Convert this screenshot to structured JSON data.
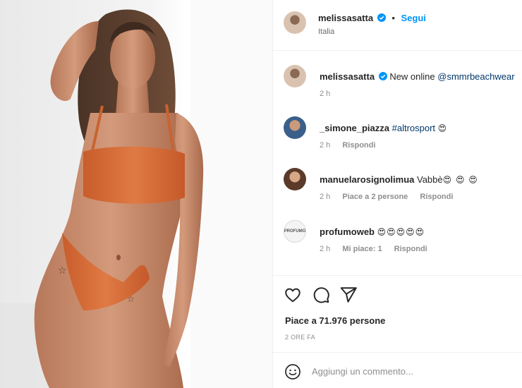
{
  "post": {
    "username": "melissasatta",
    "follow_label": "Segui",
    "dot": "•",
    "location": "Italia"
  },
  "comments": [
    {
      "username": "melissasatta",
      "text": "New online",
      "mention": "@smmrbeachwear",
      "time": "2 h"
    },
    {
      "username": "_simone_piazza",
      "hashtag": "#altrosport",
      "emoji": "😍",
      "time": "2 h",
      "reply": "Rispondi"
    },
    {
      "username": "manuelarosignolimua",
      "text": "Vabbè",
      "emoji": "😍 😍 😍",
      "time": "2 h",
      "likes": "Piace a 2 persone",
      "reply": "Rispondi"
    },
    {
      "username": "profumoweb",
      "emoji": "😍😍😍😍😍",
      "time": "2 h",
      "likes": "Mi piace: 1",
      "reply": "Rispondi",
      "avatar_text": "PROFUMO"
    }
  ],
  "actions": {
    "likes_text": "Piace a 71.976 persone",
    "time_ago": "2 ORE FA",
    "comment_placeholder": "Aggiungi un commento..."
  },
  "icons": {
    "like": "heart-icon",
    "comment": "comment-icon",
    "share": "paper-plane-icon",
    "verified": "verified-badge-icon",
    "emoji": "smiley-icon"
  },
  "colors": {
    "accent": "#0095f6",
    "link": "#00376b",
    "secondary_text": "#8e8e8e",
    "bikini": "#d9703a"
  }
}
